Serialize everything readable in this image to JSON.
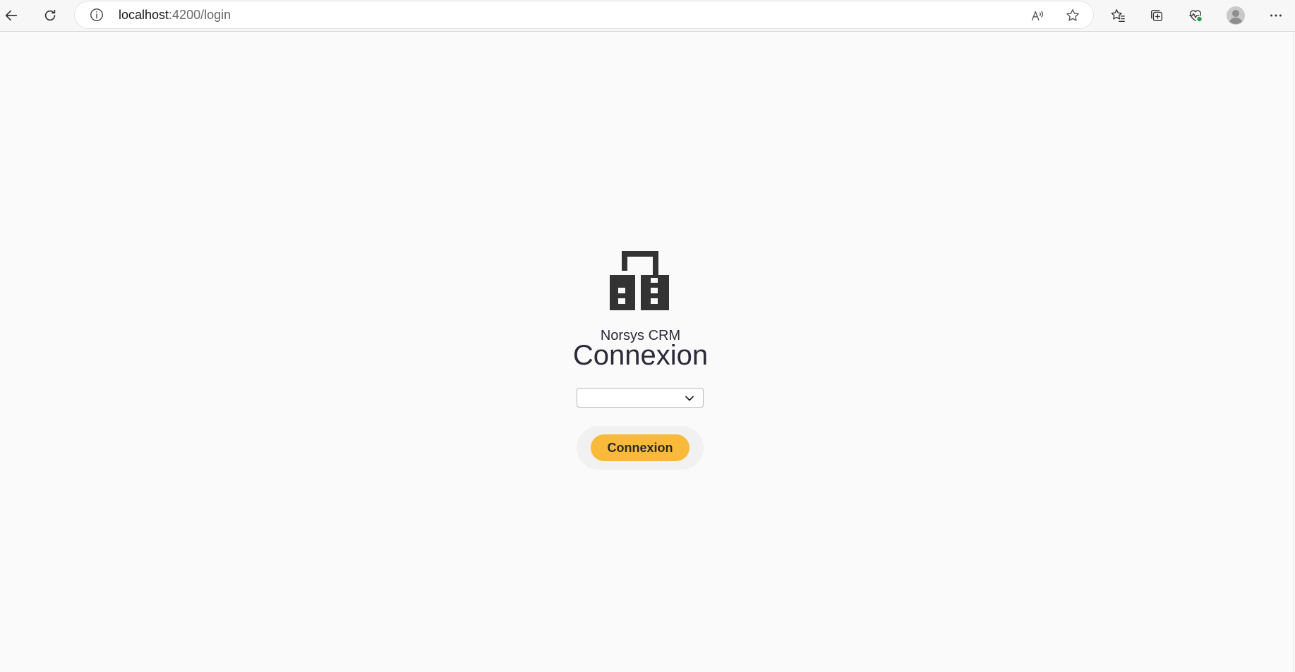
{
  "browser": {
    "url_host": "localhost",
    "url_path": ":4200/login",
    "icons": {
      "back": "back-arrow-icon",
      "reload": "reload-icon",
      "info": "info-icon",
      "read_aloud": "read-aloud-icon",
      "favorite": "star-icon",
      "favorites": "favorites-icon",
      "collections": "collections-icon",
      "performance": "heart-pulse-icon",
      "profile": "profile-avatar-icon",
      "more": "more-menu-icon"
    }
  },
  "login": {
    "brand": "Norsys CRM",
    "title": "Connexion",
    "select": {
      "value": ""
    },
    "submit_label": "Connexion"
  },
  "colors": {
    "accent": "#f9b93a",
    "text": "#2b2b3a",
    "page_bg": "#fafafa"
  }
}
